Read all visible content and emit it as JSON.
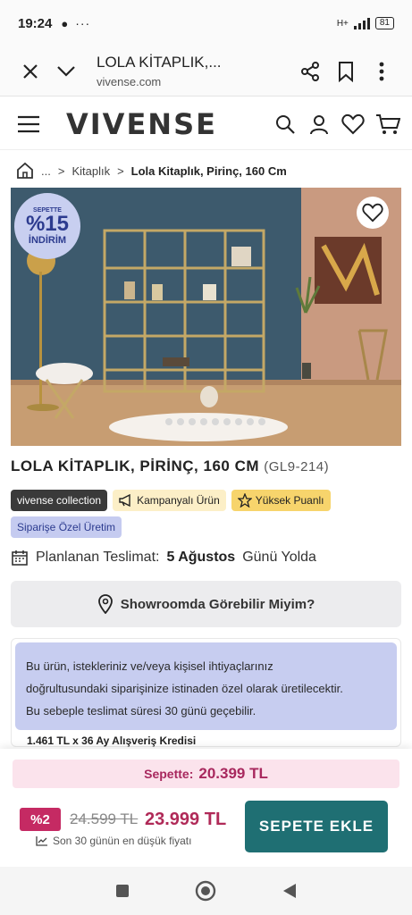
{
  "status_bar": {
    "time": "19:24",
    "battery": "81",
    "network": "H+"
  },
  "browser": {
    "title": "LOLA KİTAPLIK,...",
    "domain": "vivense.com"
  },
  "site": {
    "logo": "VIVENSE"
  },
  "breadcrumb": {
    "ellipsis": "...",
    "category": "Kitaplık",
    "current": "Lola Kitaplık, Pirinç, 160 Cm"
  },
  "badge": {
    "line1": "SEPETTE",
    "line2": "%15",
    "line3": "İNDİRİM"
  },
  "gallery": {
    "slide_count": 9
  },
  "product": {
    "title": "LOLA KİTAPLIK, PİRİNÇ, 160 CM",
    "code": "(GL9-214)"
  },
  "tags": [
    {
      "label": "vivense collection",
      "style": "dark"
    },
    {
      "label": "Kampanyalı Ürün",
      "style": "yellow-light",
      "icon": "megaphone-icon"
    },
    {
      "label": "Yüksek Puanlı",
      "style": "yellow",
      "icon": "star-icon"
    },
    {
      "label": "Siparişe Özel Üretim",
      "style": "purple"
    }
  ],
  "delivery": {
    "prefix": "Planlanan Teslimat:",
    "date": "5 Ağustos",
    "suffix": "Günü Yolda"
  },
  "showroom": {
    "label": "Showroomda Görebilir Miyim?"
  },
  "info": {
    "line1": "Bu ürün, istekleriniz ve/veya kişisel ihtiyaçlarınız",
    "line2": "doğrultusundaki siparişinize istinaden özel olarak üretilecektir.",
    "line3": "Bu sebeple teslimat süresi 30 günü geçebilir."
  },
  "credit": {
    "text": "1.461 TL x 36 Ay Alışveriş Kredisi"
  },
  "pricing": {
    "basket_label": "Sepette:",
    "basket_price": "20.399 TL",
    "discount": "%2",
    "old_price": "24.599 TL",
    "price": "23.999 TL",
    "lowest_note": "Son 30 günün en düşük fiyatı"
  },
  "cta": {
    "add_to_cart": "SEPETE EKLE"
  },
  "colors": {
    "accent": "#1f6f73",
    "price": "#b02a58",
    "badge_bg": "#c8cff0"
  }
}
